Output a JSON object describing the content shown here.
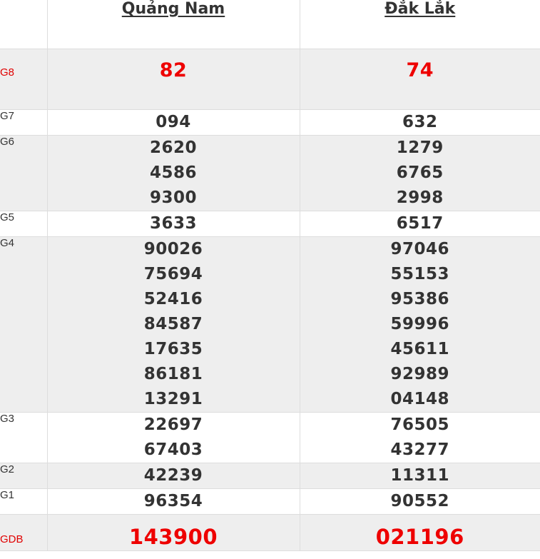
{
  "provinces": [
    "Quảng Nam",
    "Đắk Lắk"
  ],
  "prizes": [
    {
      "label": "G8",
      "highlight": true,
      "values": [
        [
          "82"
        ],
        [
          "74"
        ]
      ]
    },
    {
      "label": "G7",
      "highlight": false,
      "values": [
        [
          "094"
        ],
        [
          "632"
        ]
      ]
    },
    {
      "label": "G6",
      "highlight": false,
      "values": [
        [
          "2620",
          "4586",
          "9300"
        ],
        [
          "1279",
          "6765",
          "2998"
        ]
      ]
    },
    {
      "label": "G5",
      "highlight": false,
      "values": [
        [
          "3633"
        ],
        [
          "6517"
        ]
      ]
    },
    {
      "label": "G4",
      "highlight": false,
      "values": [
        [
          "90026",
          "75694",
          "52416",
          "84587",
          "17635",
          "86181",
          "13291"
        ],
        [
          "97046",
          "55153",
          "95386",
          "59996",
          "45611",
          "92989",
          "04148"
        ]
      ]
    },
    {
      "label": "G3",
      "highlight": false,
      "values": [
        [
          "22697",
          "67403"
        ],
        [
          "76505",
          "43277"
        ]
      ]
    },
    {
      "label": "G2",
      "highlight": false,
      "values": [
        [
          "42239"
        ],
        [
          "11311"
        ]
      ]
    },
    {
      "label": "G1",
      "highlight": false,
      "values": [
        [
          "96354"
        ],
        [
          "90552"
        ]
      ]
    },
    {
      "label": "GDB",
      "highlight": true,
      "values": [
        [
          "143900"
        ],
        [
          "021196"
        ]
      ]
    }
  ],
  "colors": {
    "highlight": "#ee0000",
    "text": "#333333",
    "row_shade": "#eeeeee",
    "border": "#dddddd"
  }
}
